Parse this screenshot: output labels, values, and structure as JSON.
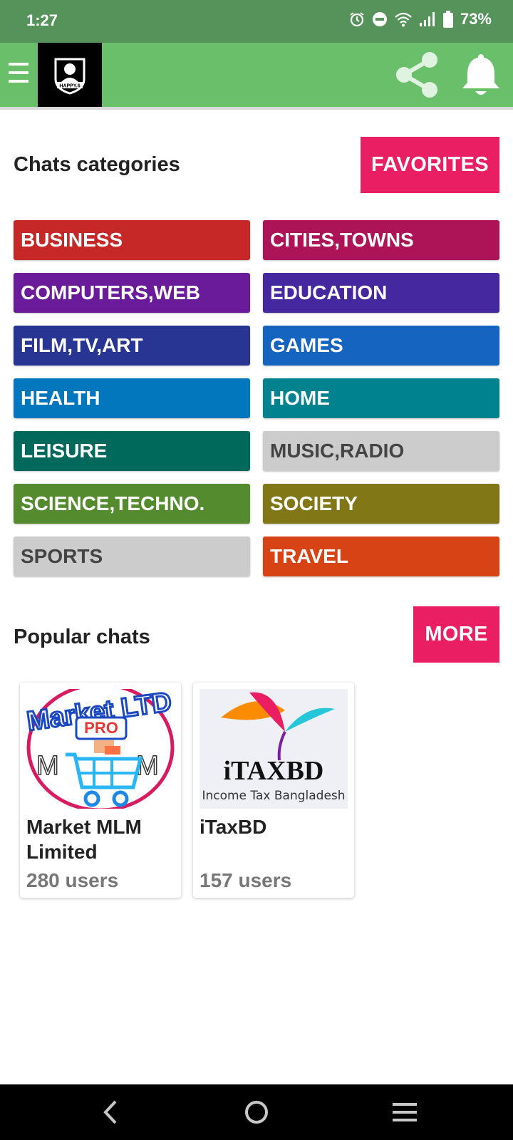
{
  "status_bar": {
    "time": "1:27",
    "battery": "73%",
    "icons": [
      "alarm-icon",
      "do-not-disturb-icon",
      "wifi-icon",
      "signal-icon",
      "battery-icon"
    ]
  },
  "app_bar": {
    "menu_icon": "hamburger-menu-icon",
    "logo_text": "HAPPY.6",
    "share_icon": "share-icon",
    "bell_icon": "bell-icon",
    "background": "#6abf6b"
  },
  "categories_section": {
    "title": "Chats categories",
    "favorites_label": "FAVORITES",
    "items": [
      {
        "label": "BUSINESS",
        "color": "#c62828"
      },
      {
        "label": "CITIES,TOWNS",
        "color": "#ad1457"
      },
      {
        "label": "COMPUTERS,WEB",
        "color": "#6a1b9a"
      },
      {
        "label": "EDUCATION",
        "color": "#4527a0"
      },
      {
        "label": "FILM,TV,ART",
        "color": "#283593"
      },
      {
        "label": "GAMES",
        "color": "#1565c0"
      },
      {
        "label": "HEALTH",
        "color": "#0277bd"
      },
      {
        "label": "HOME",
        "color": "#00838f"
      },
      {
        "label": "LEISURE",
        "color": "#00695c"
      },
      {
        "label": "MUSIC,RADIO",
        "color": "#cccccc"
      },
      {
        "label": "SCIENCE,TECHNO.",
        "color": "#558b2f"
      },
      {
        "label": "SOCIETY",
        "color": "#827717"
      },
      {
        "label": "SPORTS",
        "color": "#cccccc"
      },
      {
        "label": "TRAVEL",
        "color": "#d84315"
      }
    ]
  },
  "popular_section": {
    "title": "Popular chats",
    "more_label": "MORE",
    "chats": [
      {
        "name": "Market MLM Limited",
        "users": "280 users",
        "image_text": [
          "Market LTD",
          "PRO",
          "M",
          "M"
        ]
      },
      {
        "name": "iTaxBD",
        "users": "157 users",
        "image_text": [
          "iTAXBD",
          "Income Tax Bangladesh"
        ]
      }
    ]
  },
  "nav_bar": {
    "back_icon": "back-icon",
    "home_icon": "home-icon",
    "recents_icon": "recents-icon"
  }
}
